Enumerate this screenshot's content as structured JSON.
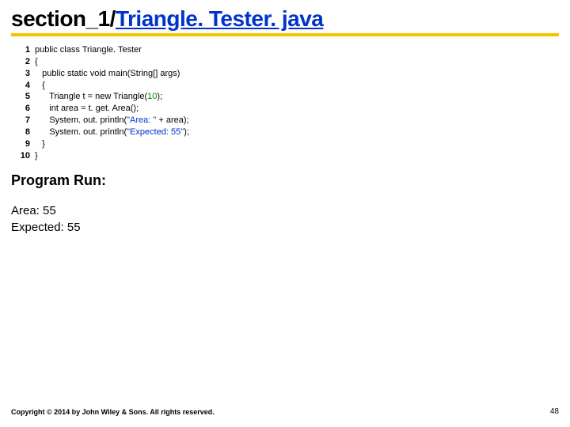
{
  "title": {
    "prefix": "section_1/",
    "link": "Triangle. Tester. java"
  },
  "code": {
    "lines": [
      {
        "n": "1",
        "segs": [
          {
            "t": "public class Triangle. Tester"
          }
        ]
      },
      {
        "n": "2",
        "segs": [
          {
            "t": "{"
          }
        ]
      },
      {
        "n": "3",
        "segs": [
          {
            "t": "   public static void main(String[] args)"
          }
        ]
      },
      {
        "n": "4",
        "segs": [
          {
            "t": "   {"
          }
        ]
      },
      {
        "n": "5",
        "segs": [
          {
            "t": "      Triangle t = new Triangle("
          },
          {
            "t": "10",
            "cls": "num-lit"
          },
          {
            "t": ");"
          }
        ]
      },
      {
        "n": "6",
        "segs": [
          {
            "t": "      int area = t. get. Area();"
          }
        ]
      },
      {
        "n": "7",
        "segs": [
          {
            "t": "      System. out. println("
          },
          {
            "t": "\"Area: \"",
            "cls": "str-lit"
          },
          {
            "t": " + area);"
          }
        ]
      },
      {
        "n": "8",
        "segs": [
          {
            "t": "      System. out. println("
          },
          {
            "t": "\"Expected: 55\"",
            "cls": "str-lit"
          },
          {
            "t": ");"
          }
        ]
      },
      {
        "n": "9",
        "segs": [
          {
            "t": "   }"
          }
        ]
      },
      {
        "n": "10",
        "segs": [
          {
            "t": "}"
          }
        ]
      }
    ]
  },
  "run": {
    "heading": "Program Run:",
    "output": "Area: 55\nExpected: 55"
  },
  "footer": {
    "copyright": "Copyright © 2014 by John Wiley & Sons. All rights reserved.",
    "page": "48"
  }
}
